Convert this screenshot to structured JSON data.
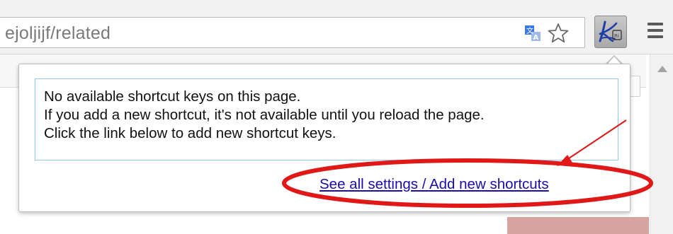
{
  "omnibox": {
    "url_text": "ejoljijf/related"
  },
  "icons": {
    "translate": "translate-icon",
    "bookmark": "bookmark-star-icon",
    "extension": "shortcut-extension-icon",
    "menu": "hamburger-menu-icon"
  },
  "popup": {
    "message_lines": [
      "No available shortcut keys on this page.",
      "If you add a new shortcut, it's not available until you reload the page.",
      "Click the link below to add new shortcut keys."
    ],
    "link_label": "See all settings / Add new shortcuts"
  },
  "colors": {
    "link": "#1a0dab",
    "message_border": "#8fc7ec",
    "annotation": "#e01818"
  }
}
